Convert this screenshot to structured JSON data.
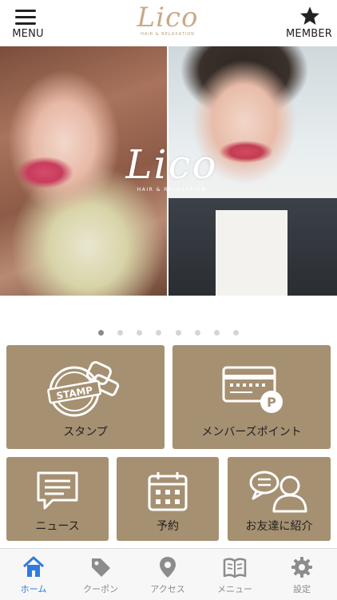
{
  "header": {
    "menu_label": "MENU",
    "member_label": "MEMBER",
    "logo_text": "Lico",
    "logo_sub": "HAIR & RELAXATION"
  },
  "hero": {
    "logo_text": "Lico",
    "logo_sub": "HAIR & RELAXATION",
    "slide_count": 8,
    "active_slide": 1
  },
  "tiles": {
    "stamp": {
      "label": "スタンプ",
      "icon_text": "STAMP"
    },
    "points": {
      "label": "メンバーズポイント",
      "icon_text": "P"
    },
    "news": {
      "label": "ニュース"
    },
    "reserve": {
      "label": "予約"
    },
    "friend": {
      "label": "お友達に紹介"
    }
  },
  "tabs": [
    {
      "label": "ホーム",
      "icon": "home-icon",
      "active": true
    },
    {
      "label": "クーポン",
      "icon": "tag-icon",
      "active": false
    },
    {
      "label": "アクセス",
      "icon": "map-pin-icon",
      "active": false
    },
    {
      "label": "メニュー",
      "icon": "book-icon",
      "active": false
    },
    {
      "label": "設定",
      "icon": "gear-icon",
      "active": false
    }
  ],
  "colors": {
    "tile_bg": "#a69072",
    "tab_active": "#2f7be0",
    "tab_inactive": "#8c8c8c",
    "logo_gold": "#c9aa86"
  }
}
